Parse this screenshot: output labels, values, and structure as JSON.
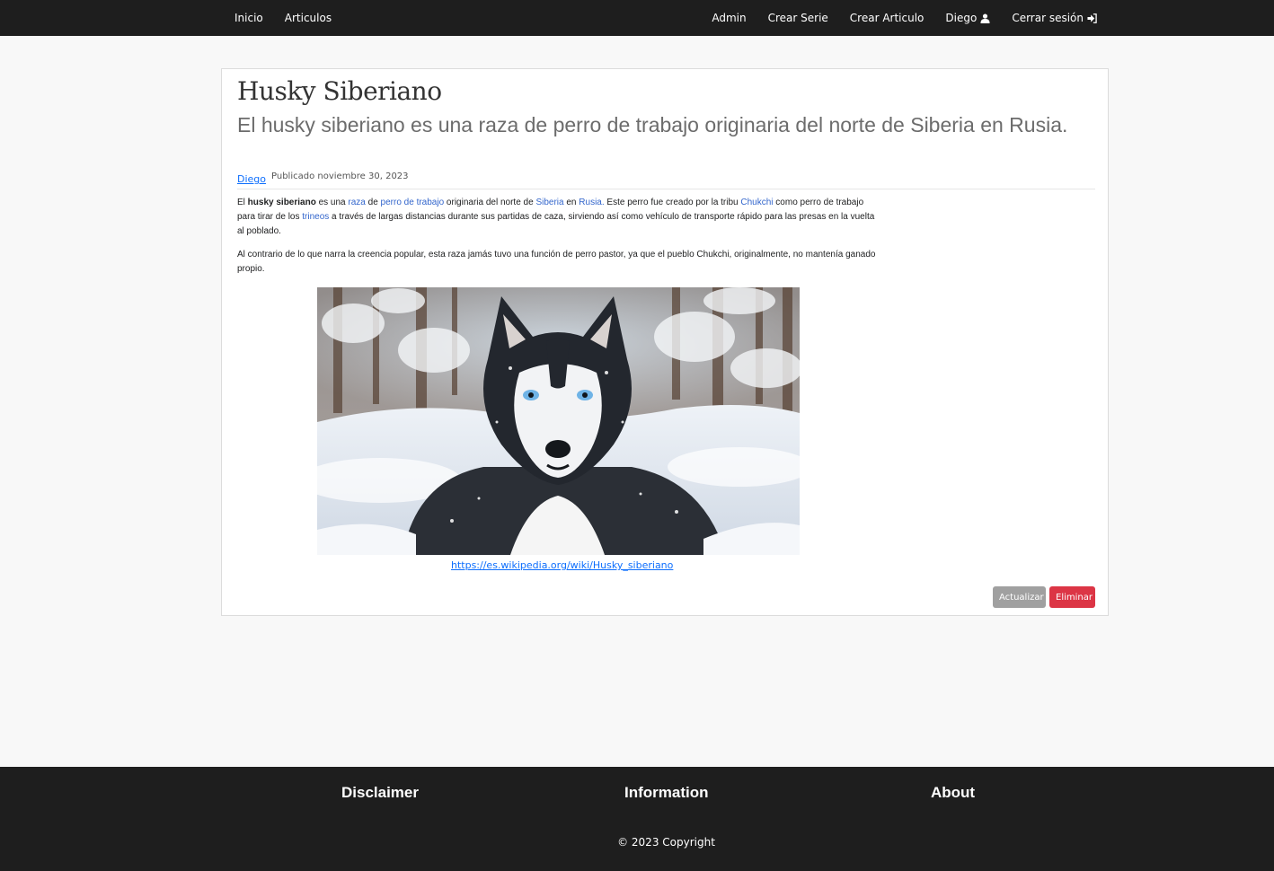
{
  "nav": {
    "left": [
      "Inicio",
      "Articulos"
    ],
    "admin": "Admin",
    "create_series": "Crear Serie",
    "create_article": "Crear Articulo",
    "user": "Diego",
    "logout": "Cerrar sesión"
  },
  "article": {
    "title": "Husky Siberiano",
    "subtitle": "El husky siberiano es una raza de perro de trabajo originaria del norte de Siberia en Rusia.",
    "author": "Diego",
    "published": "Publicado noviembre 30, 2023",
    "p1": {
      "t0": "El ",
      "bold": "husky siberiano",
      "t1": " es una ",
      "l_raza": "raza",
      "t2": " de ",
      "l_perro": "perro de trabajo",
      "t3": " originaria del norte de ",
      "l_siberia": "Siberia",
      "t4": " en ",
      "l_rusia": "Rusia.",
      "t5": " Este perro fue creado por la tribu ",
      "l_chukchi": "Chukchi",
      "t6": " como perro de trabajo para tirar de los ",
      "l_trineos": "trineos",
      "t7": " a través de largas distancias durante sus partidas de caza, sirviendo así como vehículo de transporte rápido para las presas en la vuelta al poblado."
    },
    "p2": "Al contrario de lo que narra la creencia popular, esta raza jamás tuvo una función de perro pastor, ya que el pueblo Chukchi, originalmente, no mantenía ganado propio.",
    "image_subject": "husky lying in snow in a winter forest",
    "source_url": "https://es.wikipedia.org/wiki/Husky_siberiano",
    "btn_update": "Actualizar",
    "btn_delete": "Eliminar"
  },
  "footer": {
    "col1": "Disclaimer",
    "col2": "Information",
    "col3": "About",
    "copyright": "© 2023 Copyright"
  },
  "colors": {
    "navbar": "#1e1e1e",
    "link": "#0d6efd",
    "delete": "#dc3545",
    "update": "#a0a0a0"
  },
  "icons": [
    "user-icon",
    "logout-icon"
  ]
}
